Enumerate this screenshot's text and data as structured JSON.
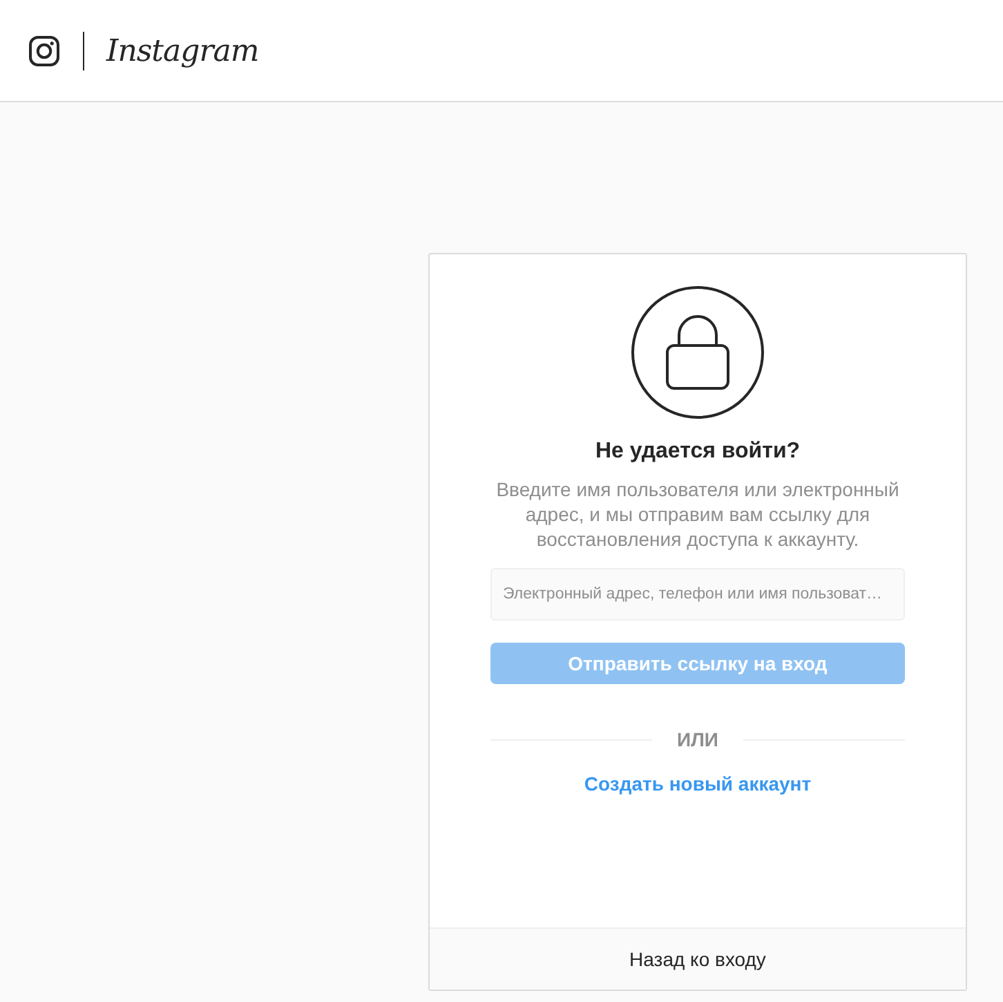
{
  "header": {
    "logo": "Instagram"
  },
  "card": {
    "title": "Не удается войти?",
    "description": "Введите имя пользователя или электронный адрес, и мы отправим вам ссылку для восстановления доступа к аккаунту.",
    "input": {
      "placeholder": "Электронный адрес, телефон или имя пользоват…"
    },
    "submit_button": {
      "label": "Отправить ссылку на вход",
      "disabled": true
    },
    "divider_text": "ИЛИ",
    "create_account_link": "Создать новый аккаунт",
    "back_to_login": "Назад ко входу"
  }
}
